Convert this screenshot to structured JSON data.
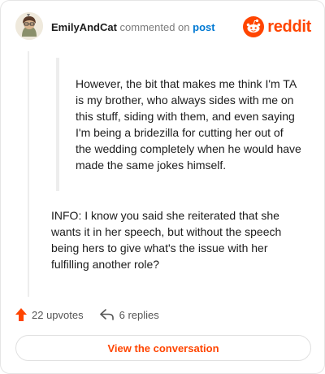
{
  "header": {
    "username": "EmilyAndCat",
    "action_text": " commented on ",
    "post_link": "post",
    "brand_wordmark": "reddit"
  },
  "comment": {
    "quote": "However, the bit that makes me think I'm TA is my brother, who always sides with me on this stuff, siding with them, and even saying I'm being a bridezilla for cutting her out of the wedding completely when he would have made the same jokes himself.",
    "body": "INFO: I know you said she reiterated that she wants it in her speech, but without the speech being hers to give what's the issue with her fulfilling another role?"
  },
  "footer": {
    "upvotes": "22 upvotes",
    "replies": "6 replies"
  },
  "cta": {
    "label": "View the conversation"
  },
  "colors": {
    "brand": "#ff4500",
    "link": "#0079d3",
    "upvote_icon": "upvote-arrow-icon",
    "reply_icon": "reply-arrow-icon"
  }
}
